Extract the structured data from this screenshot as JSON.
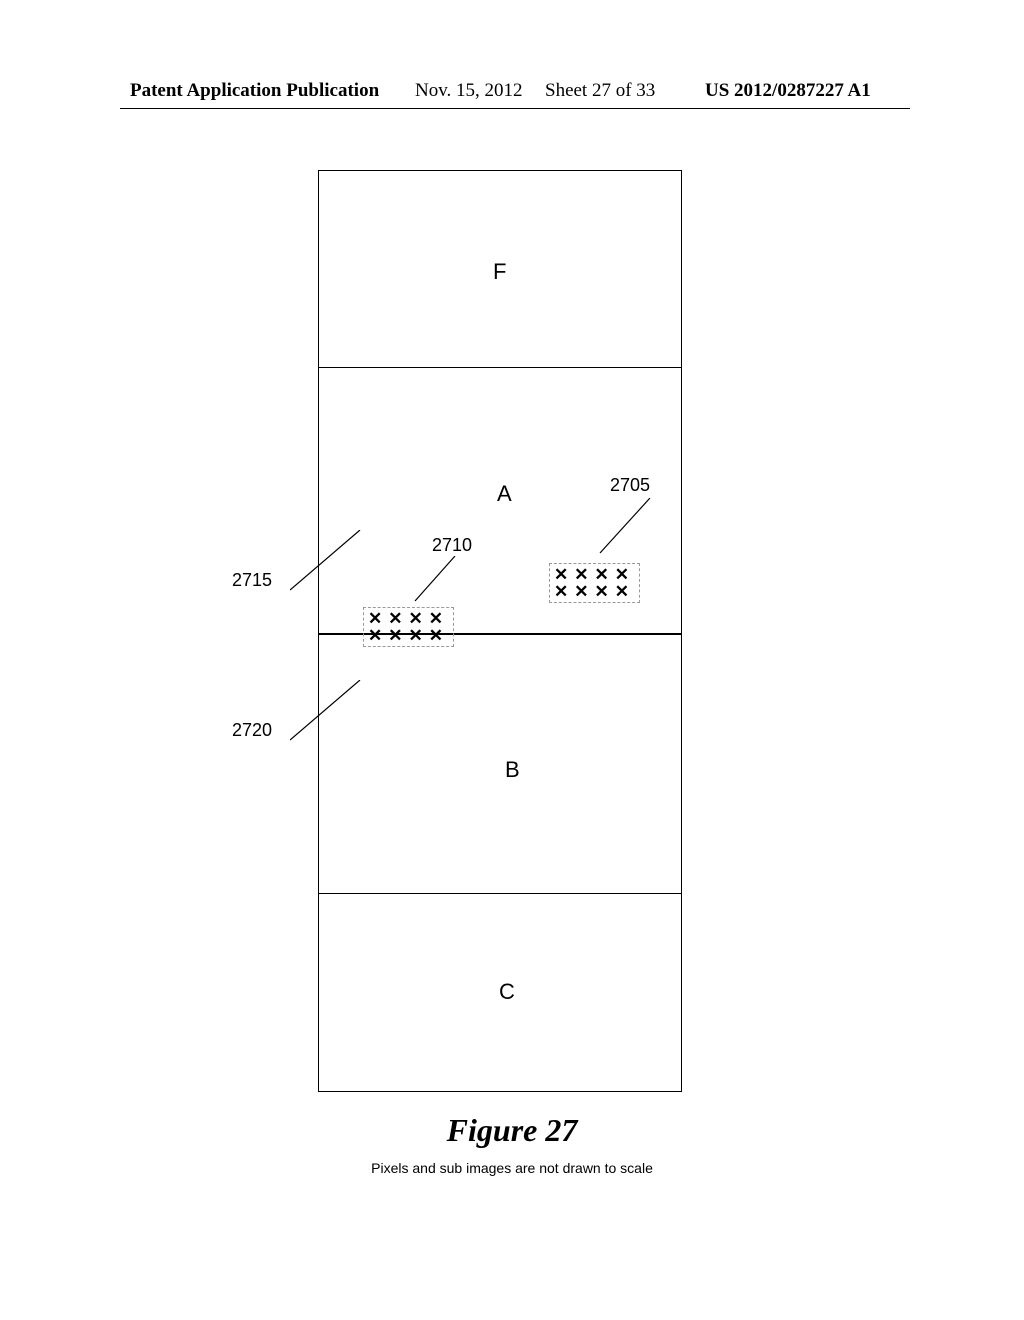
{
  "header": {
    "publication_label": "Patent Application Publication",
    "date": "Nov. 15, 2012",
    "sheet": "Sheet 27 of 33",
    "pub_number": "US 2012/0287227 A1"
  },
  "regions": {
    "F": "F",
    "A": "A",
    "B": "B",
    "C": "C"
  },
  "refs": {
    "r2705": "2705",
    "r2710": "2710",
    "r2715": "2715",
    "r2720": "2720"
  },
  "figure": {
    "title": "Figure 27",
    "note": "Pixels and sub images are not drawn to scale"
  },
  "x_glyph": "✕"
}
